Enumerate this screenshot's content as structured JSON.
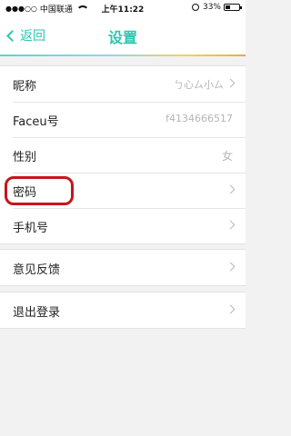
{
  "status_bar": {
    "carrier": "中国联通",
    "signal_dots": "●●●○○",
    "time": "上午11:22",
    "battery": "33%",
    "battery_level": 0.33
  },
  "nav": {
    "back_label": "返回",
    "title": "设置"
  },
  "profile_group": [
    {
      "label": "昵称",
      "value": "ㄅ心ㄙ小ㄙ",
      "has_arrow": true
    },
    {
      "label": "Faceu号",
      "value": "f4134666517",
      "has_arrow": false
    },
    {
      "label": "性别",
      "value": "女",
      "has_arrow": false
    },
    {
      "label": "密码",
      "value": "",
      "has_arrow": true,
      "highlighted": true
    },
    {
      "label": "手机号",
      "value": "",
      "has_arrow": true
    }
  ],
  "feedback_group": [
    {
      "label": "意见反馈",
      "has_arrow": true
    }
  ],
  "logout_group": [
    {
      "label": "退出登录",
      "has_arrow": true
    }
  ],
  "colors": {
    "accent": "#2cc5b0",
    "highlight_circle": "#c4161c",
    "background": "#f2f2f2"
  }
}
